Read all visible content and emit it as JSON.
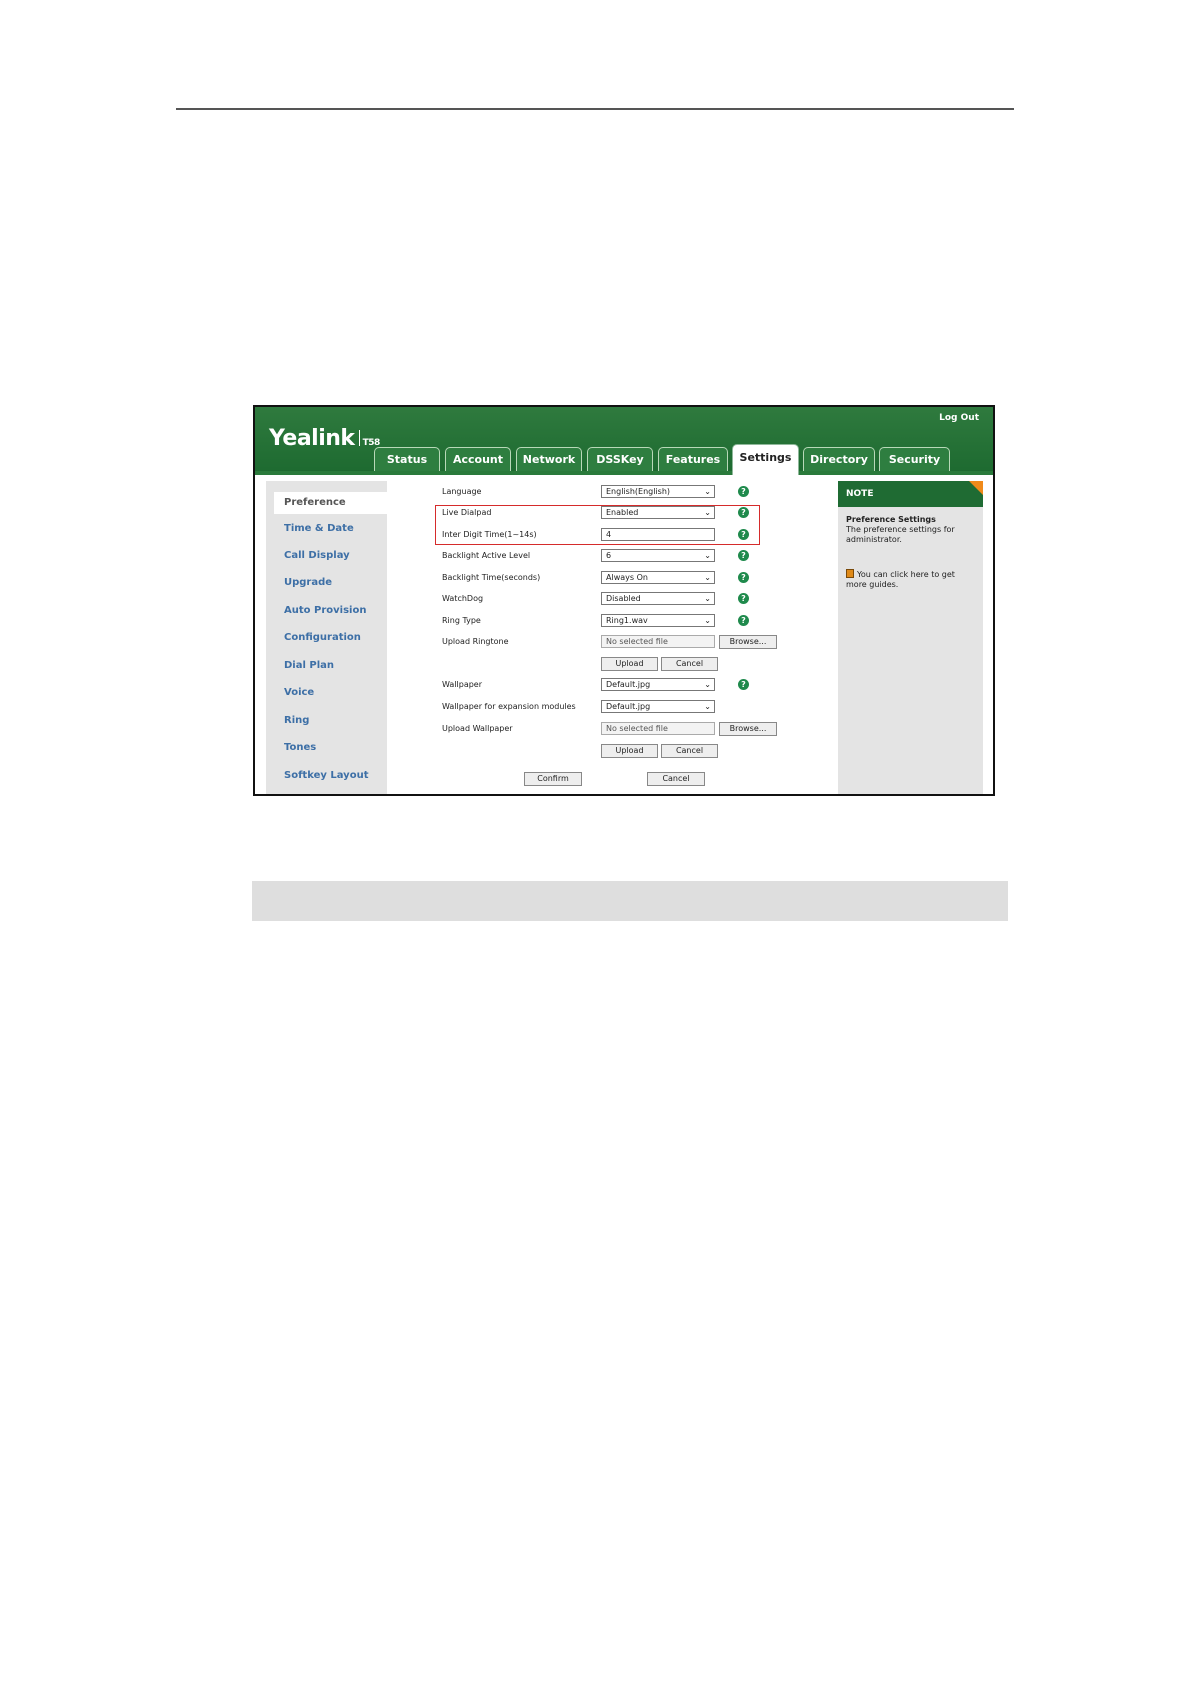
{
  "app": {
    "logo": "Yealink",
    "model": "T58",
    "logout_label": "Log Out",
    "accent_color": "#1d6a30"
  },
  "tabs": [
    {
      "label": "Status"
    },
    {
      "label": "Account"
    },
    {
      "label": "Network"
    },
    {
      "label": "DSSKey"
    },
    {
      "label": "Features"
    },
    {
      "label": "Settings",
      "active": true
    },
    {
      "label": "Directory"
    },
    {
      "label": "Security"
    }
  ],
  "sidebar": {
    "active": "Preference",
    "items": [
      {
        "label": "Time & Date"
      },
      {
        "label": "Call Display"
      },
      {
        "label": "Upgrade"
      },
      {
        "label": "Auto Provision"
      },
      {
        "label": "Configuration"
      },
      {
        "label": "Dial Plan"
      },
      {
        "label": "Voice"
      },
      {
        "label": "Ring"
      },
      {
        "label": "Tones"
      },
      {
        "label": "Softkey Layout"
      }
    ]
  },
  "form": {
    "language": {
      "label": "Language",
      "value": "English(English)"
    },
    "live_dialpad": {
      "label": "Live Dialpad",
      "value": "Enabled"
    },
    "inter_digit": {
      "label": "Inter Digit Time(1~14s)",
      "value": "4"
    },
    "backlight_level": {
      "label": "Backlight Active Level",
      "value": "6"
    },
    "backlight_time": {
      "label": "Backlight Time(seconds)",
      "value": "Always On"
    },
    "watchdog": {
      "label": "WatchDog",
      "value": "Disabled"
    },
    "ring_type": {
      "label": "Ring Type",
      "value": "Ring1.wav"
    },
    "upload_ringtone": {
      "label": "Upload Ringtone",
      "file": "No selected file",
      "browse": "Browse...",
      "upload": "Upload",
      "cancel": "Cancel"
    },
    "wallpaper": {
      "label": "Wallpaper",
      "value": "Default.jpg"
    },
    "wallpaper_exp": {
      "label": "Wallpaper for expansion modules",
      "value": "Default.jpg"
    },
    "upload_wallpaper": {
      "label": "Upload Wallpaper",
      "file": "No selected file",
      "browse": "Browse...",
      "upload": "Upload",
      "cancel": "Cancel"
    },
    "confirm": "Confirm",
    "cancel": "Cancel"
  },
  "note": {
    "header": "NOTE",
    "title": "Preference Settings",
    "text": "The preference settings for administrator.",
    "guide": "You can click here to get more guides."
  }
}
